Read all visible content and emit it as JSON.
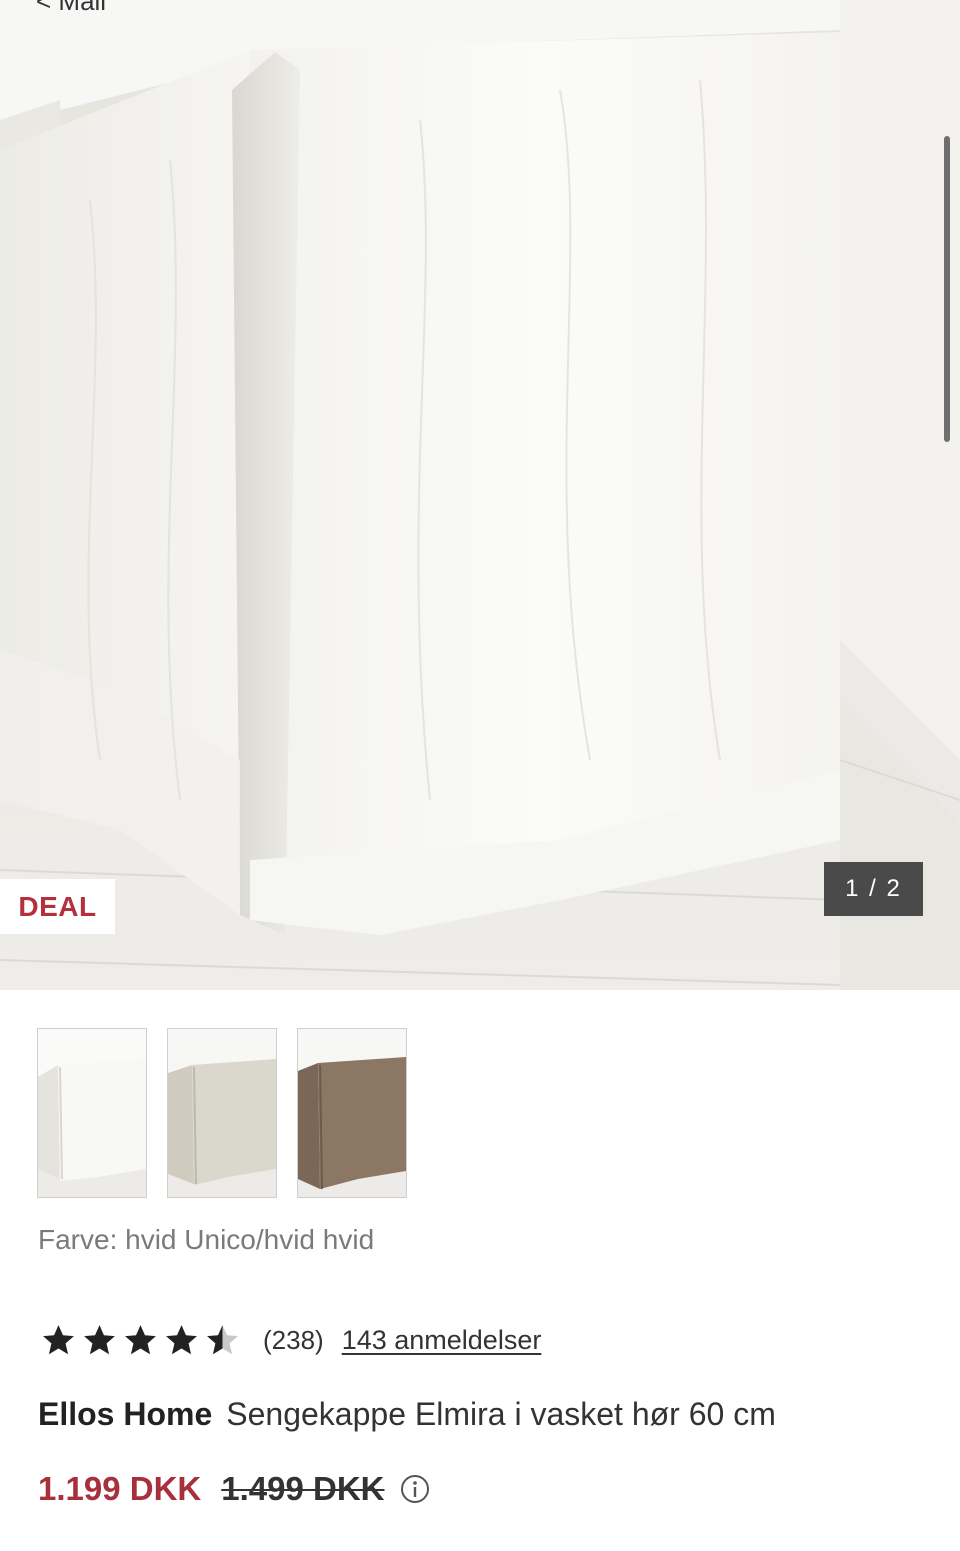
{
  "nav": {
    "back_label": "< Mail"
  },
  "gallery": {
    "badge": "DEAL",
    "counter": "1 / 2",
    "current_index": 1,
    "total": 2,
    "thumbnails": [
      {
        "name": "white",
        "color": "#f4f3f0"
      },
      {
        "name": "sand",
        "color": "#d9d6cb"
      },
      {
        "name": "brown",
        "color": "#8a7563"
      }
    ]
  },
  "product": {
    "color_label": "Farve: hvid Unico/hvid hvid",
    "rating": {
      "value": 4.5,
      "max": 5,
      "count_text": "(238)",
      "reviews_link": "143 anmeldelser"
    },
    "brand": "Ellos Home",
    "name": "Sengekappe Elmira i vasket hør 60 cm",
    "price": "1.199 DKK",
    "old_price": "1.499 DKK"
  },
  "colors": {
    "price_red": "#a8303d",
    "badge_red": "#b3303c",
    "counter_bg": "#4a4a4a"
  },
  "icons": {
    "star": "star-icon",
    "info": "info-icon"
  }
}
